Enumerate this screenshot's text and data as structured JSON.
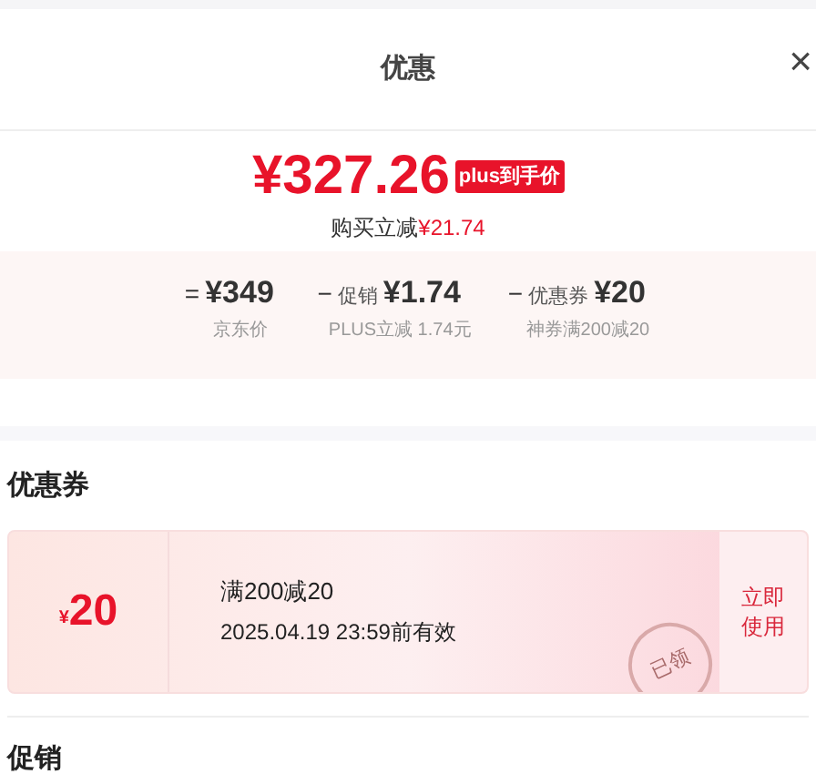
{
  "header": {
    "title": "优惠",
    "close": "×"
  },
  "price": {
    "amount": "¥327.26",
    "badge": "plus到手价",
    "saving_label": "购买立减",
    "saving_amount": "¥21.74"
  },
  "breakdown": [
    {
      "op": "=",
      "amount": "¥349",
      "caption": "京东价"
    },
    {
      "op": "−",
      "name": "促销",
      "amount": "¥1.74",
      "caption": "PLUS立减 1.74元"
    },
    {
      "op": "−",
      "name": "优惠券",
      "amount": "¥20",
      "caption": "神券满200减20"
    }
  ],
  "coupon_section": {
    "heading": "优惠券",
    "coupons": [
      {
        "currency": "¥",
        "value": "20",
        "title": "满200减20",
        "validity": "2025.04.19 23:59前有效",
        "stamp": "已领",
        "action": "立即使用"
      }
    ]
  },
  "promo_section": {
    "heading": "促销"
  }
}
